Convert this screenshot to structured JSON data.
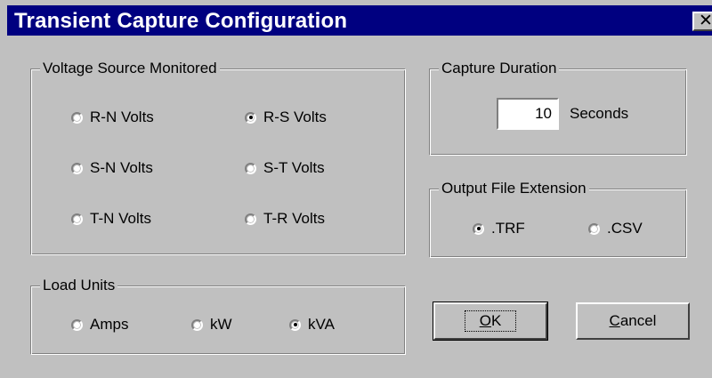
{
  "window": {
    "title": "Transient Capture Configuration",
    "close_glyph": "✕"
  },
  "voltage_group": {
    "label": "Voltage Source Monitored",
    "options": [
      {
        "label": "R-N Volts",
        "checked": false
      },
      {
        "label": "R-S Volts",
        "checked": true
      },
      {
        "label": "S-N Volts",
        "checked": false
      },
      {
        "label": "S-T Volts",
        "checked": false
      },
      {
        "label": "T-N Volts",
        "checked": false
      },
      {
        "label": "T-R Volts",
        "checked": false
      }
    ]
  },
  "duration_group": {
    "label": "Capture Duration",
    "value": "10",
    "unit": "Seconds"
  },
  "extension_group": {
    "label": "Output File Extension",
    "options": [
      {
        "label": ".TRF",
        "checked": true
      },
      {
        "label": ".CSV",
        "checked": false
      }
    ]
  },
  "load_group": {
    "label": "Load Units",
    "options": [
      {
        "label": "Amps",
        "checked": false
      },
      {
        "label": "kW",
        "checked": false
      },
      {
        "label": "kVA",
        "checked": true
      }
    ]
  },
  "buttons": {
    "ok_accel": "O",
    "ok_rest": "K",
    "cancel_accel": "C",
    "cancel_rest": "ancel"
  },
  "colors": {
    "titlebar": "#000080",
    "face": "#c0c0c0"
  }
}
